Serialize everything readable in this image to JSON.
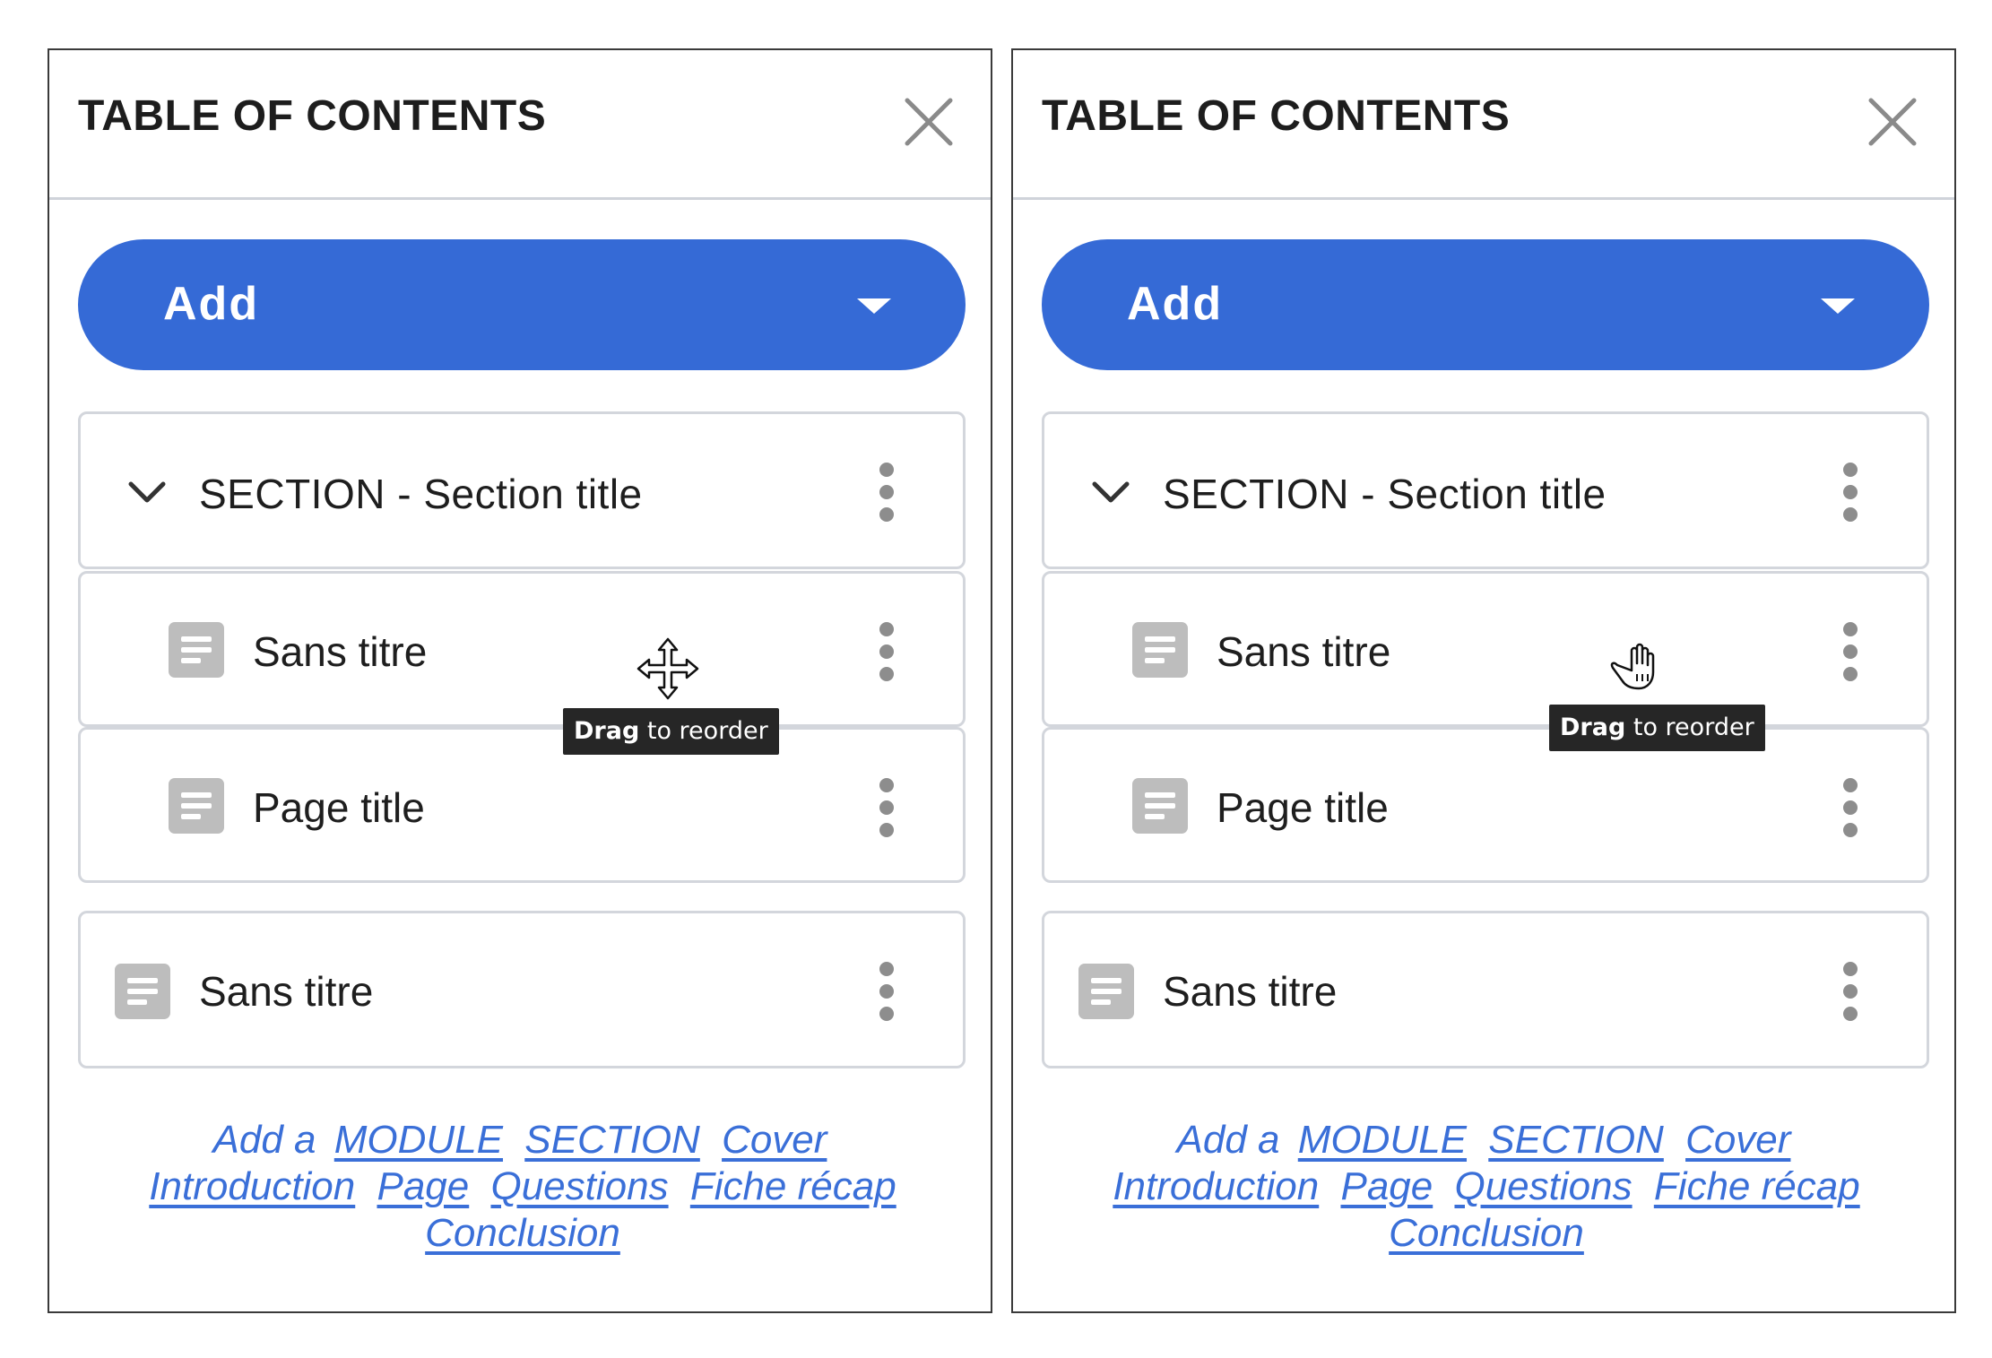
{
  "panels": [
    {
      "title": "TABLE OF CONTENTS",
      "add_label": "Add",
      "section": {
        "label": "SECTION  - Section title"
      },
      "items": [
        {
          "label": "Sans titre"
        },
        {
          "label": "Page title"
        },
        {
          "label": "Sans titre"
        }
      ],
      "cursor": "move-cursor",
      "tooltip": {
        "bold": "Drag",
        "rest": " to reorder"
      },
      "footer": {
        "prefix": "Add a",
        "links": [
          "MODULE",
          "SECTION",
          "Cover",
          "Introduction",
          "Page",
          "Questions",
          "Fiche récap",
          "Conclusion"
        ]
      }
    },
    {
      "title": "TABLE OF CONTENTS",
      "add_label": "Add",
      "section": {
        "label": "SECTION  - Section title"
      },
      "items": [
        {
          "label": "Sans titre"
        },
        {
          "label": "Page title"
        },
        {
          "label": "Sans titre"
        }
      ],
      "cursor": "grab-hand-cursor",
      "tooltip": {
        "bold": "Drag",
        "rest": " to reorder"
      },
      "footer": {
        "prefix": "Add a",
        "links": [
          "MODULE",
          "SECTION",
          "Cover",
          "Introduction",
          "Page",
          "Questions",
          "Fiche récap",
          "Conclusion"
        ]
      }
    }
  ],
  "colors": {
    "primary": "#356ad6",
    "link": "#3a6fd8",
    "card_border": "#d3d6dc",
    "doc_icon": "#bdbdbd",
    "kebab": "#8d8d8d",
    "tooltip_bg": "#262626"
  },
  "icons": [
    "close-icon",
    "caret-down-icon",
    "chevron-down-icon",
    "document-icon",
    "more-vertical-icon",
    "move-cursor-icon",
    "grab-hand-cursor-icon"
  ]
}
